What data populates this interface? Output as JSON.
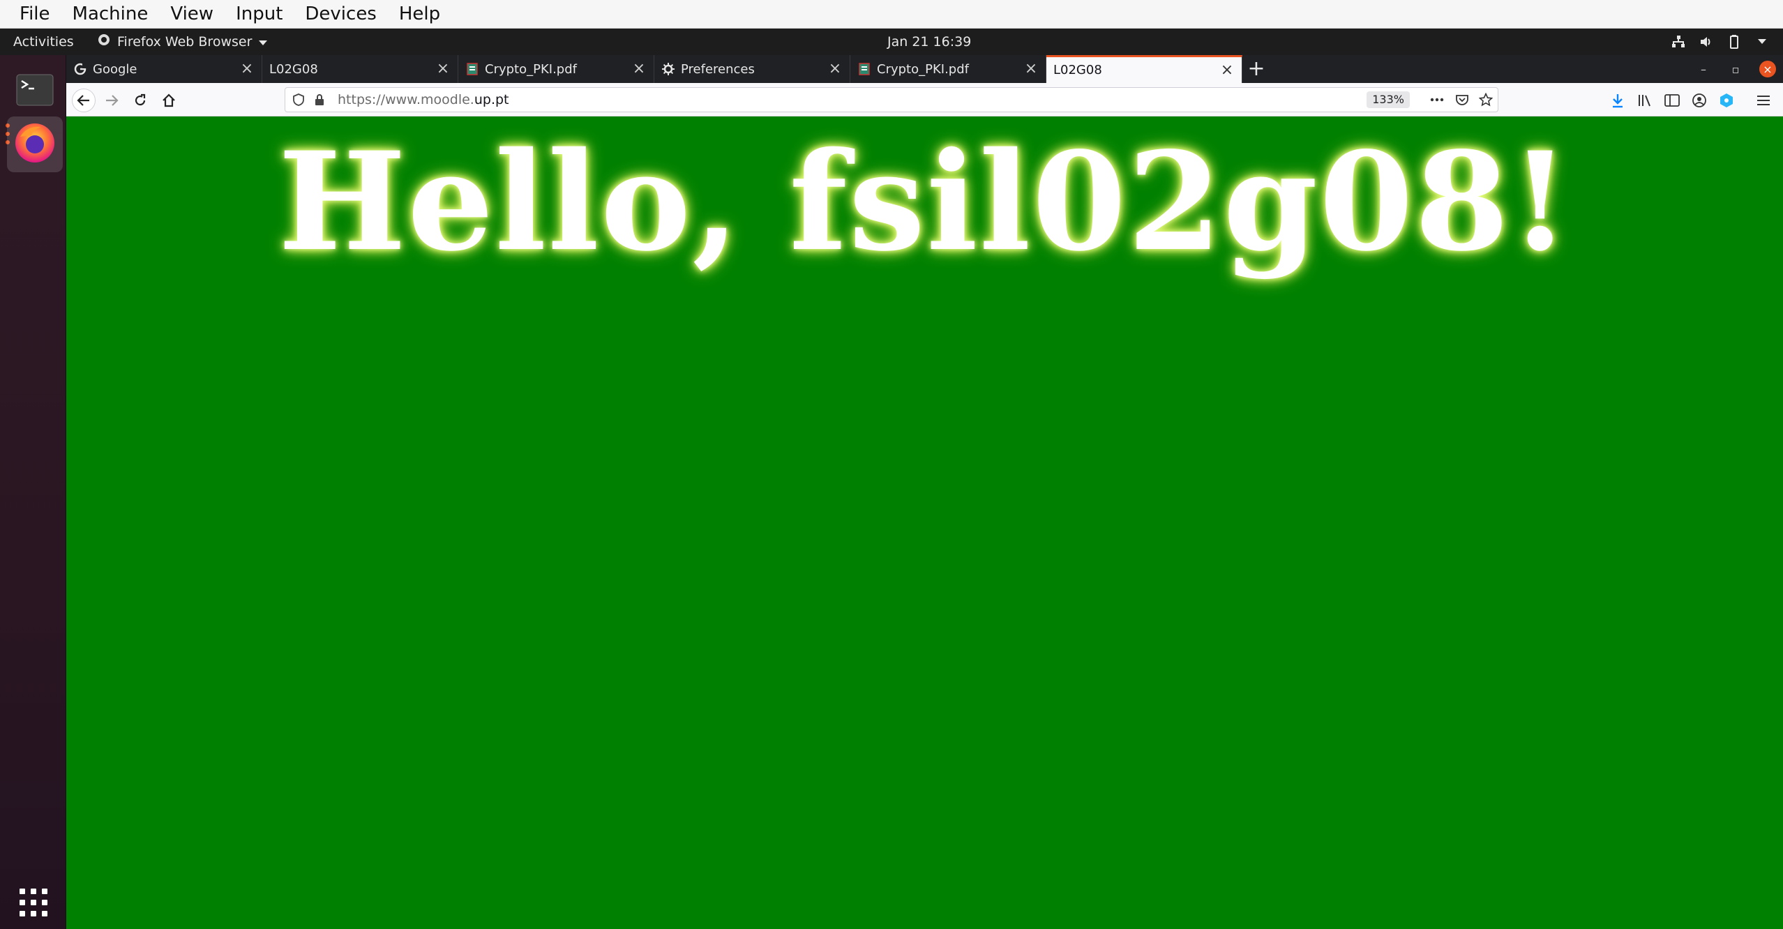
{
  "vbox_menu": {
    "items": [
      "File",
      "Machine",
      "View",
      "Input",
      "Devices",
      "Help"
    ]
  },
  "topbar": {
    "activities": "Activities",
    "app_name": "Firefox Web Browser",
    "clock": "Jan 21  16:39"
  },
  "dock": {
    "items": [
      {
        "name": "terminal",
        "icon": "terminal-icon"
      },
      {
        "name": "firefox",
        "icon": "firefox-icon"
      }
    ]
  },
  "tabs": [
    {
      "title": "Google",
      "icon": "google-icon",
      "active": false
    },
    {
      "title": "L02G08",
      "icon": "",
      "active": false
    },
    {
      "title": "Crypto_PKI.pdf",
      "icon": "pdf-icon",
      "active": false
    },
    {
      "title": "Preferences",
      "icon": "gear-icon",
      "active": false
    },
    {
      "title": "Crypto_PKI.pdf",
      "icon": "pdf-icon",
      "active": false
    },
    {
      "title": "L02G08",
      "icon": "",
      "active": true
    }
  ],
  "navbar": {
    "url_prefix": "https://www.moodle.",
    "url_domain": "up.pt",
    "zoom": "133%"
  },
  "page": {
    "greeting": "Hello, fsil02g08!",
    "background": "#008000",
    "glow": "#d8f060"
  },
  "colors": {
    "ubuntu_orange": "#e95420",
    "tab_active_bg": "#f9f9fb",
    "tabbar_bg": "#202124"
  }
}
